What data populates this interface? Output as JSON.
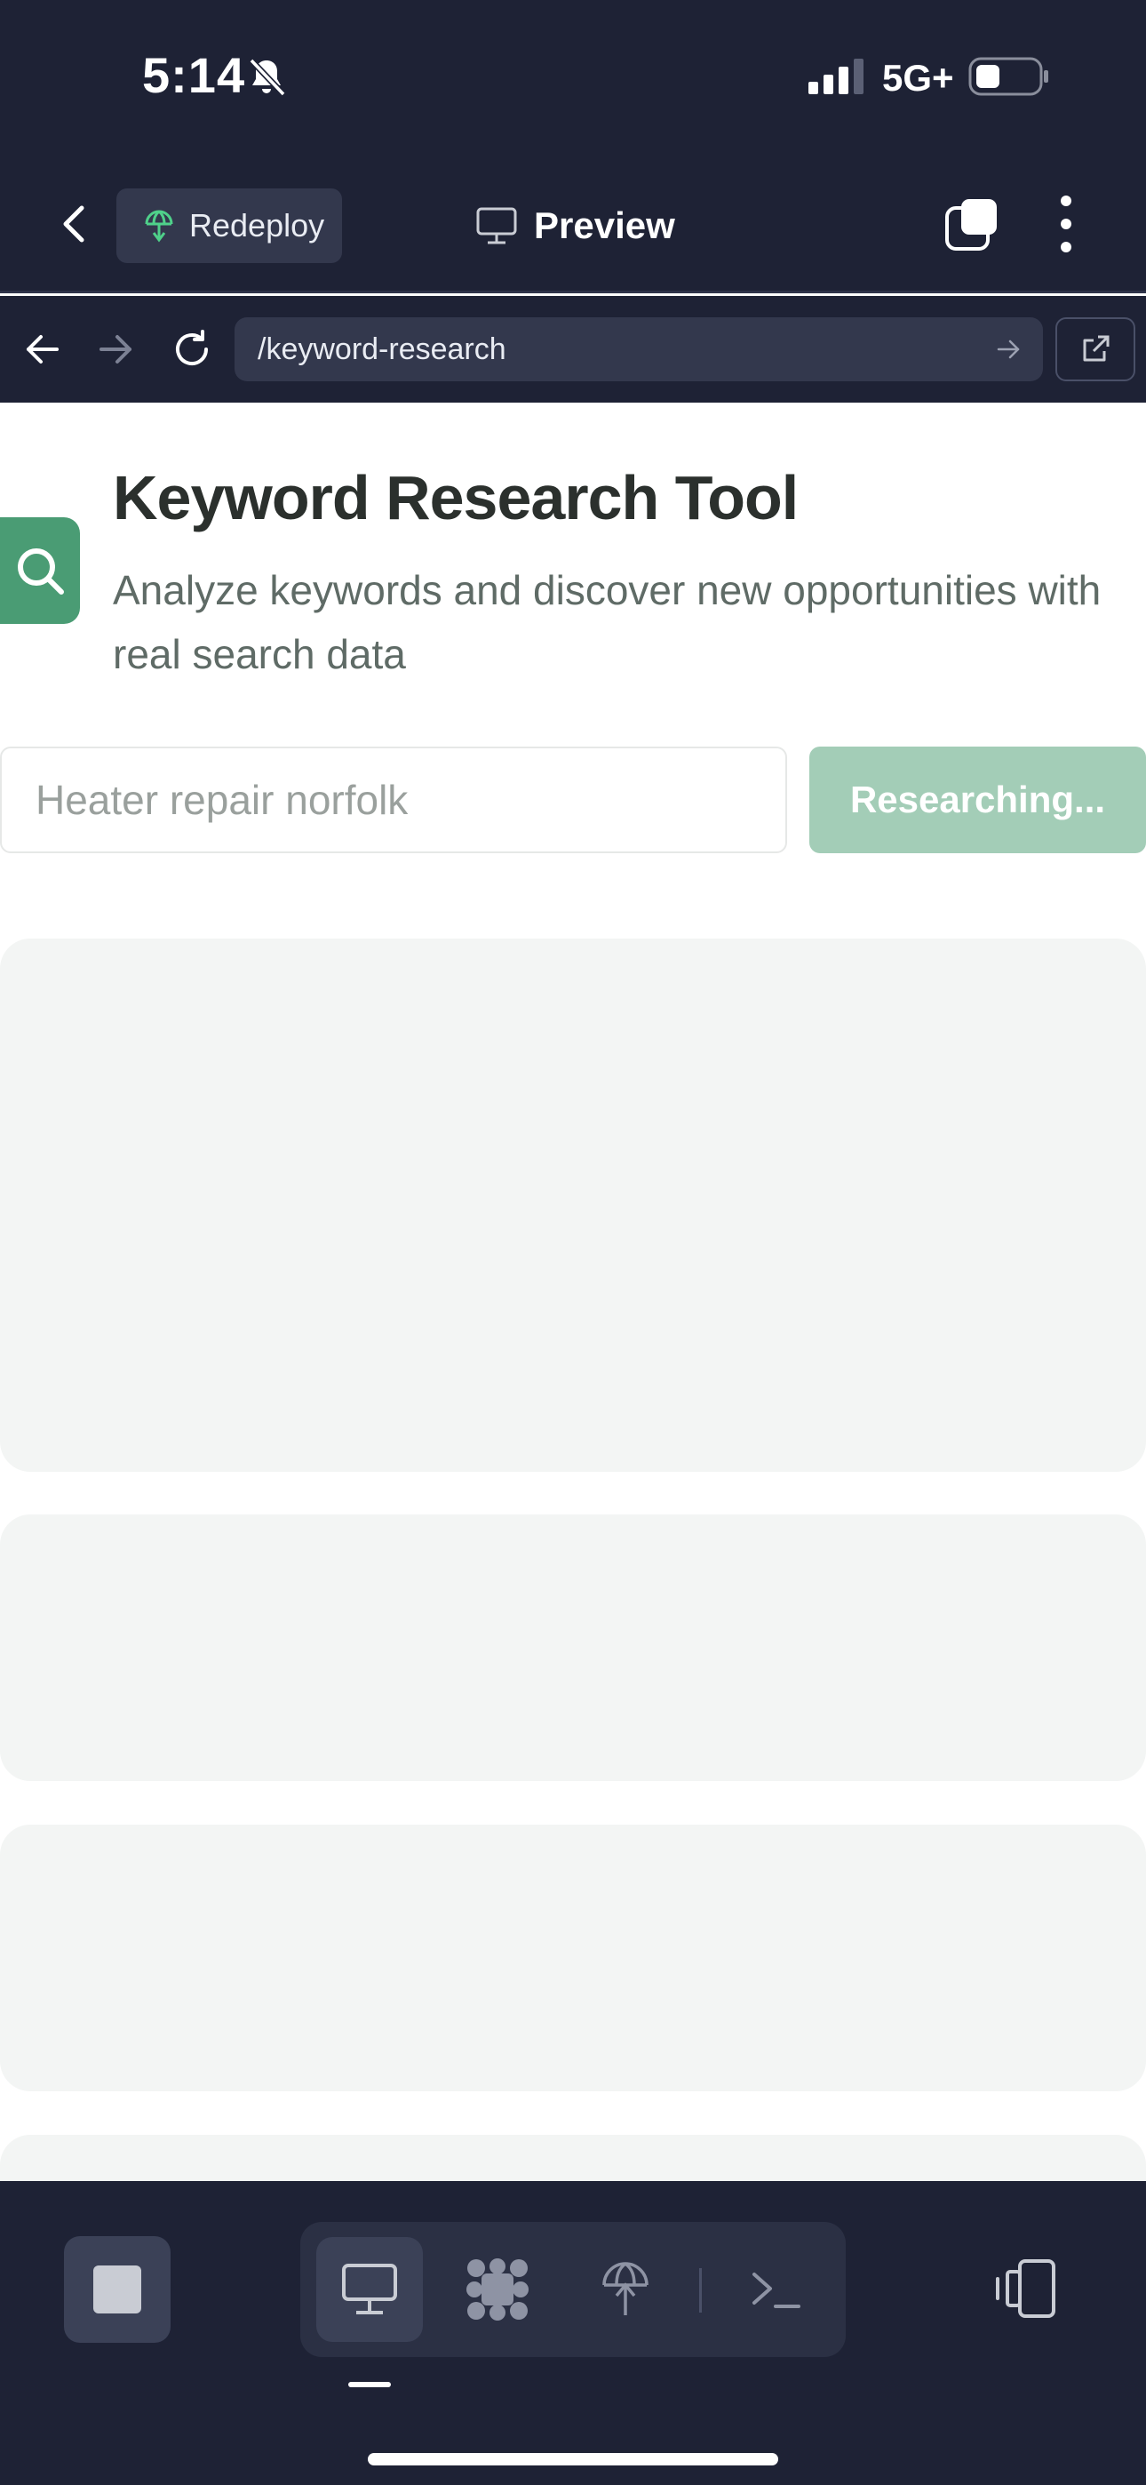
{
  "status_bar": {
    "time": "5:14",
    "network": "5G+",
    "icons": [
      "bell-slash-icon",
      "signal-icon",
      "battery-icon"
    ]
  },
  "header": {
    "back_icon": "chevron-left-icon",
    "redeploy_label": "Redeploy",
    "redeploy_icon": "globe-arrow-icon",
    "title": "Preview",
    "title_icon": "monitor-icon",
    "tabs_icon": "tabs-icon",
    "menu_icon": "more-vertical-icon"
  },
  "browser": {
    "url": "/keyword-research",
    "icons": [
      "arrow-left-icon",
      "arrow-right-icon",
      "reload-icon",
      "external-link-icon"
    ]
  },
  "page": {
    "title": "Keyword Research Tool",
    "subtitle": "Analyze keywords and discover new opportunities with real search data",
    "search_placeholder": "Heater repair norfolk",
    "button_label": "Researching...",
    "colors": {
      "brand": "#4a9c74",
      "button_disabled": "#a3cdb7",
      "skeleton": "#f3f5f4",
      "chrome_dark": "#1e2235"
    }
  },
  "toolbar": {
    "items": [
      "stop-icon",
      "monitor-icon",
      "agent-icon",
      "deploy-icon",
      "terminal-icon",
      "device-rotate-icon"
    ],
    "active": "monitor-icon"
  }
}
